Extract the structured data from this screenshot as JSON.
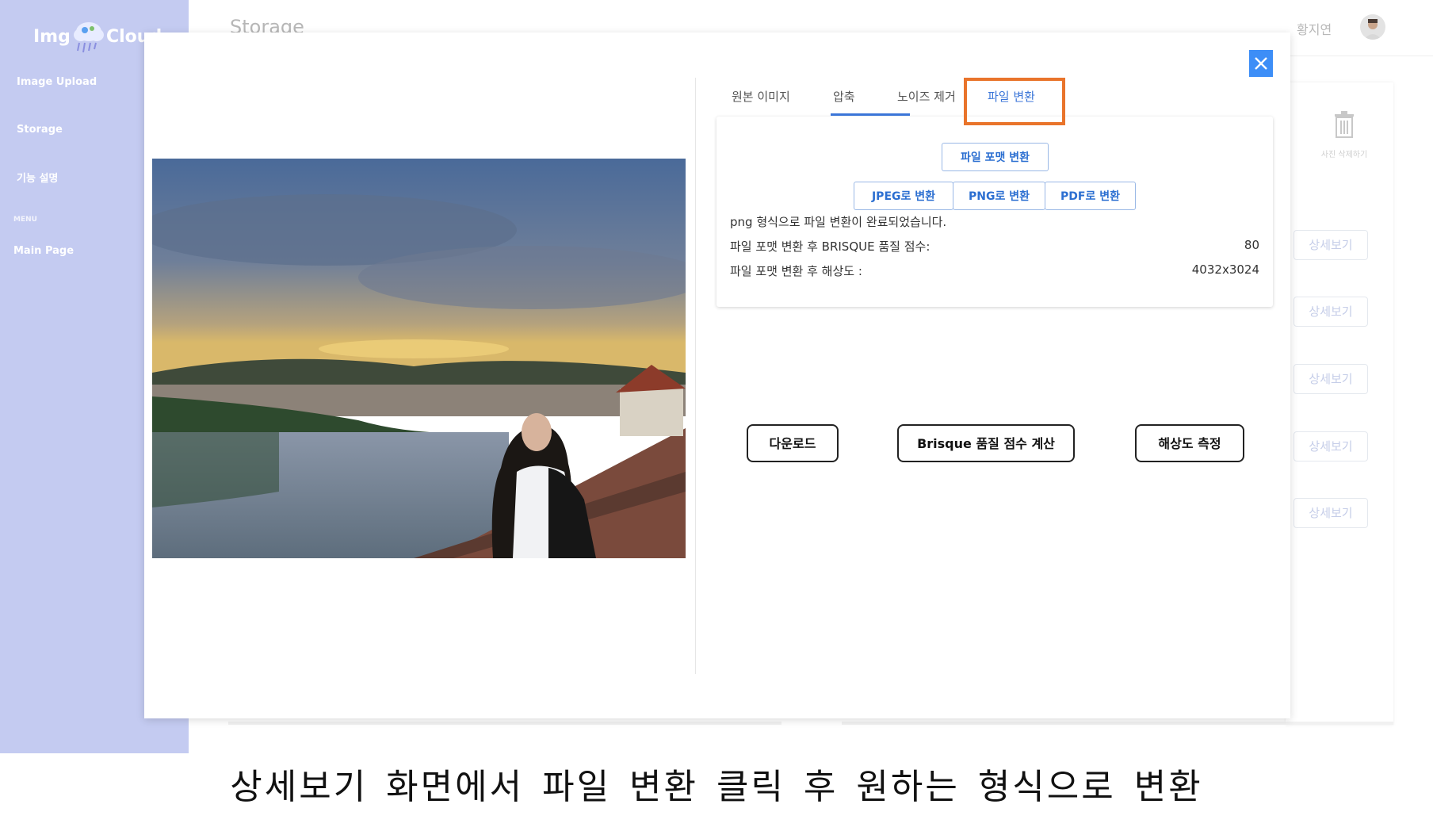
{
  "sidebar": {
    "logo_left": "Img",
    "logo_right": "Cloud",
    "items": [
      {
        "label": "Image Upload"
      },
      {
        "label": "Storage"
      },
      {
        "label": "기능 설명"
      }
    ],
    "menu_label": "MENU",
    "main_page": "Main Page"
  },
  "header": {
    "title": "Storage",
    "user_name": "황지연"
  },
  "background": {
    "trash_label": "사진 삭제하기",
    "detail_buttons": [
      "상세보기",
      "상세보기",
      "상세보기",
      "상세보기",
      "상세보기"
    ]
  },
  "modal": {
    "tabs": [
      {
        "label": "원본 이미지"
      },
      {
        "label": "압축"
      },
      {
        "label": "노이즈 제거"
      },
      {
        "label": "파일 변환",
        "active": true
      }
    ],
    "convert_panel": {
      "format_button": "파일 포맷 변환",
      "jpeg_button": "JPEG로 변환",
      "png_button": "PNG로 변환",
      "pdf_button": "PDF로 변환",
      "status_message": "png 형식으로 파일 변환이 완료되었습니다.",
      "brisque_label": "파일 포맷 변환 후 BRISQUE 품질 점수:",
      "brisque_value": "80",
      "resolution_label": "파일 포맷 변환 후 해상도 :",
      "resolution_value": "4032x3024"
    },
    "actions": {
      "download": "다운로드",
      "brisque": "Brisque 품질 점수 계산",
      "resolution": "해상도 측정"
    }
  },
  "caption": "상세보기 화면에서  파일 변환 클릭 후 원하는 형식으로 변환",
  "colors": {
    "sidebar": "#c4cbf1",
    "accent": "#3b76d8",
    "close_button": "#3d8ef7",
    "highlight": "#e9742b"
  }
}
